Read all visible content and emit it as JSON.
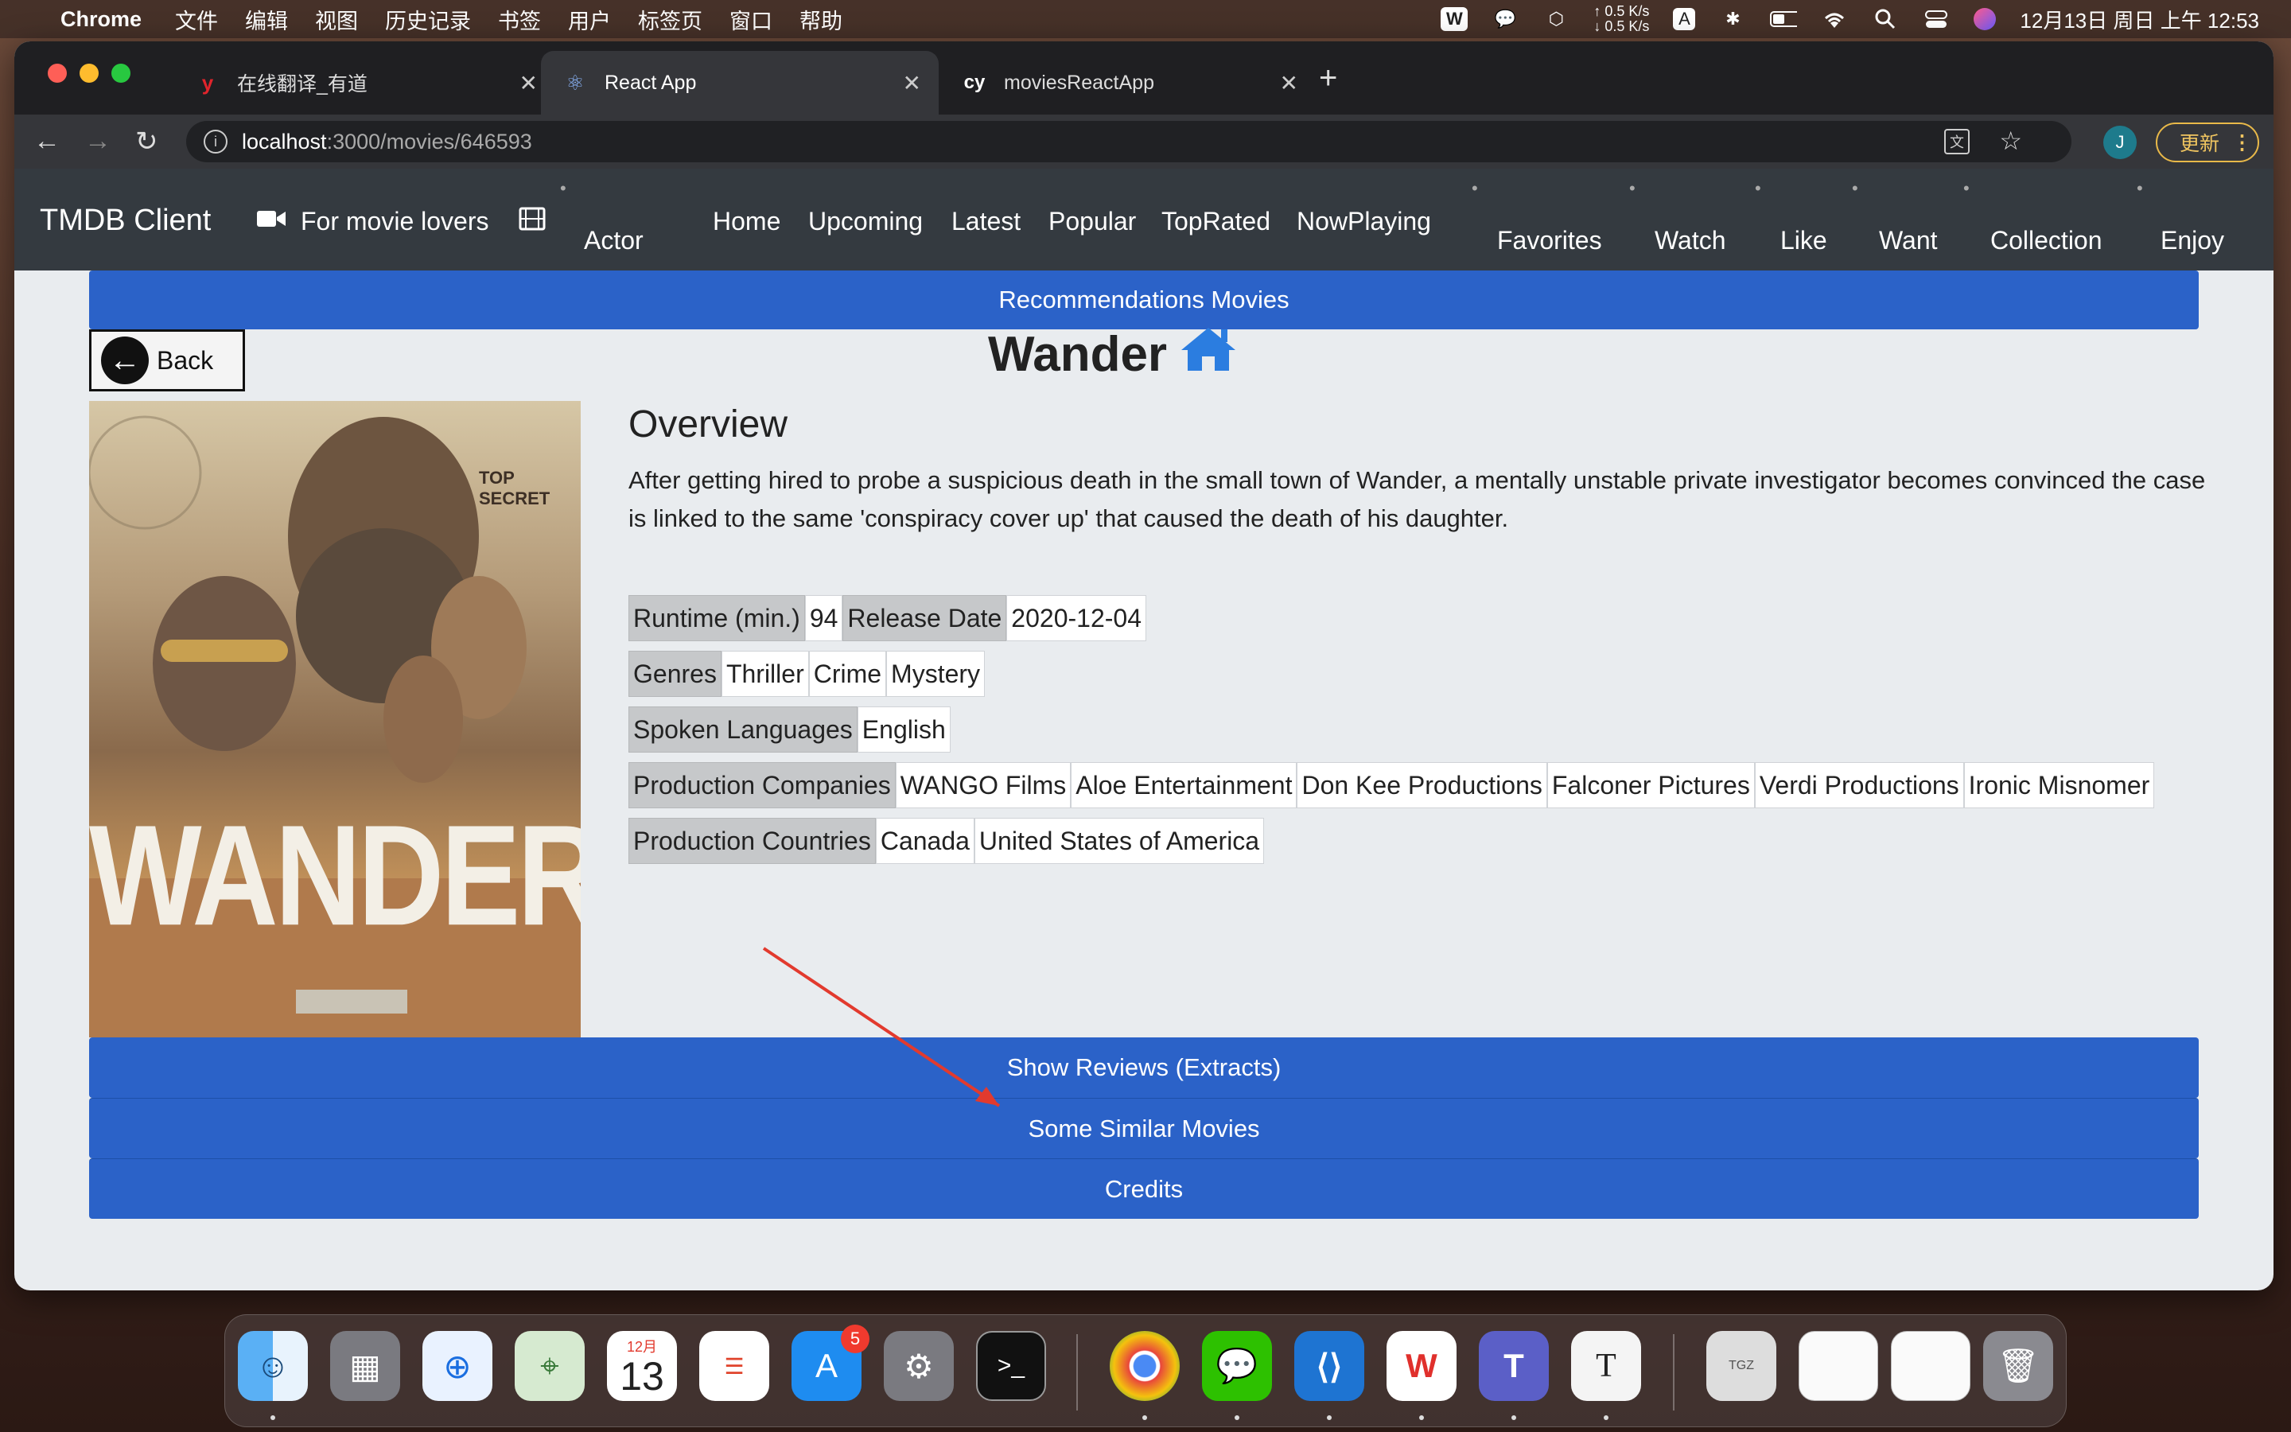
{
  "menubar": {
    "app_name": "Chrome",
    "items": [
      "文件",
      "编辑",
      "视图",
      "历史记录",
      "书签",
      "用户",
      "标签页",
      "窗口",
      "帮助"
    ],
    "net_up": "↑ 0.5 K/s",
    "net_down": "↓ 0.5 K/s",
    "input_method": "A",
    "datetime": "12月13日 周日 上午 12:53"
  },
  "tabs": [
    {
      "icon": "y",
      "title": "在线翻译_有道"
    },
    {
      "icon": "⚛",
      "title": "React App"
    },
    {
      "icon": "cy",
      "title": "moviesReactApp"
    }
  ],
  "address": {
    "host": "localhost",
    "path": ":3000/movies/646593",
    "avatar": "J",
    "update_label": "更新"
  },
  "navbar": {
    "brand": "TMDB Client",
    "tagline": "For movie lovers",
    "actor": "Actor",
    "links": [
      "Home",
      "Upcoming",
      "Latest",
      "Popular",
      "TopRated",
      "NowPlaying"
    ],
    "user_links": [
      "Favorites",
      "Watch",
      "Like",
      "Want",
      "Collection",
      "Enjoy"
    ]
  },
  "page": {
    "recommendations_label": "Recommendations Movies",
    "back_label": "Back",
    "movie_title": "Wander",
    "poster_text": "WANDER",
    "poster_stamp": "TOP SECRET",
    "overview_heading": "Overview",
    "overview_text": "After getting hired to probe a suspicious death in the small town of Wander, a mentally unstable private investigator becomes convinced the case is linked to the same 'conspiracy cover up' that caused the death of his daughter.",
    "runtime_label": "Runtime (min.)",
    "runtime": "94",
    "release_label": "Release Date",
    "release_date": "2020-12-04",
    "genres_label": "Genres",
    "genres": [
      "Thriller",
      "Crime",
      "Mystery"
    ],
    "languages_label": "Spoken Languages",
    "languages": [
      "English"
    ],
    "companies_label": "Production Companies",
    "companies": [
      "WANGO Films",
      "Aloe Entertainment",
      "Don Kee Productions",
      "Falconer Pictures",
      "Verdi Productions",
      "Ironic Misnomer"
    ],
    "countries_label": "Production Countries",
    "countries": [
      "Canada",
      "United States of America"
    ],
    "reviews_button": "Show Reviews (Extracts)",
    "similar_button": "Some Similar Movies",
    "credits_button": "Credits"
  },
  "dock": {
    "calendar_month": "12月",
    "calendar_day": "13",
    "appstore_badge": "5",
    "textedit_letter": "T"
  }
}
